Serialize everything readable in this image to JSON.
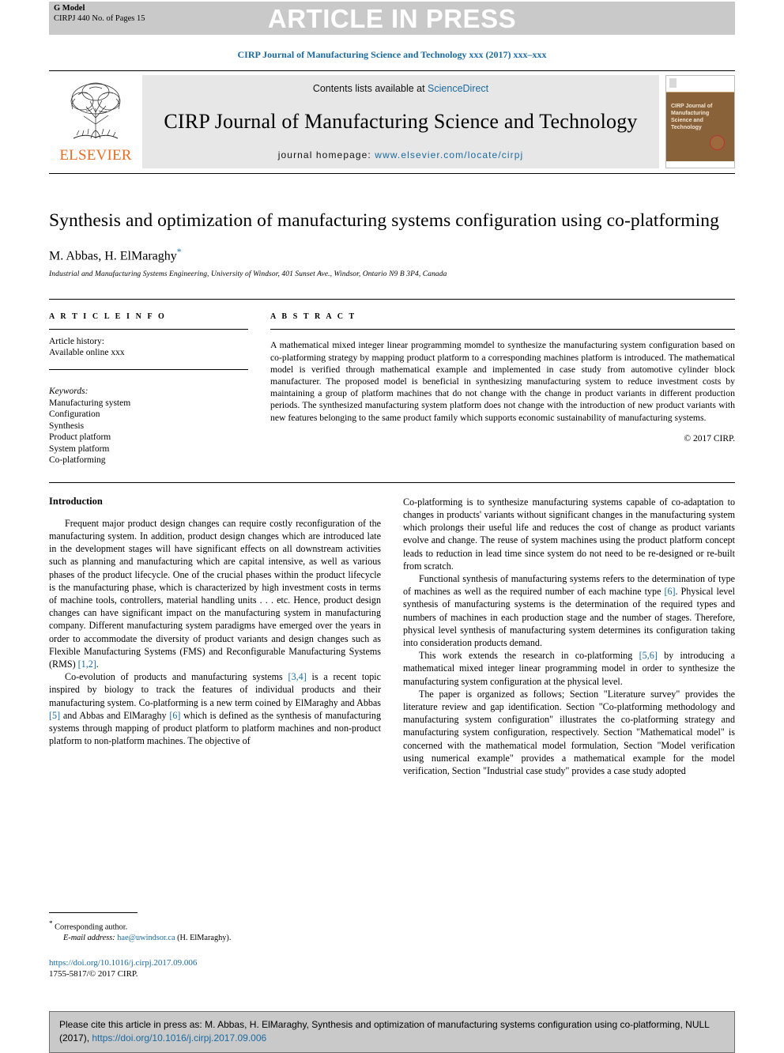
{
  "banner": {
    "g_model_line1": "G Model",
    "g_model_line2": "CIRPJ 440 No. of Pages 15",
    "article_in_press": "ARTICLE IN PRESS"
  },
  "journal_line": "CIRP Journal of Manufacturing Science and Technology xxx (2017) xxx–xxx",
  "masthead": {
    "publisher": "ELSEVIER",
    "contents_prefix": "Contents lists available at ",
    "contents_link": "ScienceDirect",
    "journal_title": "CIRP Journal of Manufacturing Science and Technology",
    "homepage_prefix": "journal homepage: ",
    "homepage_url": "www.elsevier.com/locate/cirpj",
    "cover_title": "CIRP Journal of Manufacturing Science and Technology"
  },
  "article": {
    "title": "Synthesis and optimization of manufacturing systems configuration using co-platforming",
    "authors": "M. Abbas, H. ElMaraghy",
    "corresponding_marker": "*",
    "affiliation": "Industrial and Manufacturing Systems Engineering, University of Windsor, 401 Sunset Ave., Windsor, Ontario N9 B 3P4, Canada"
  },
  "article_info": {
    "heading": "A R T I C L E   I N F O",
    "history_label": "Article history:",
    "history_value": "Available online xxx",
    "keywords_label": "Keywords:",
    "keywords": [
      "Manufacturing system",
      "Configuration",
      "Synthesis",
      "Product platform",
      "System platform",
      "Co-platforming"
    ]
  },
  "abstract": {
    "heading": "A B S T R A C T",
    "text": "A mathematical mixed integer linear programming momdel to synthesize the manufacturing system configuration based on co-platforming strategy by mapping product platform to a corresponding machines platform is introduced. The mathematical model is verified through mathematical example and implemented in case study from automotive cylinder block manufacturer. The proposed model is beneficial in synthesizing manufacturing system to reduce investment costs by maintaining a group of platform machines that do not change with the change in product variants in different production periods. The synthesized manufacturing system platform does not change with the introduction of new product variants with new features belonging to the same product family which supports economic sustainability of manufacturing systems.",
    "copyright": "© 2017 CIRP."
  },
  "body": {
    "section_heading": "Introduction",
    "left_paragraphs": [
      {
        "parts": [
          {
            "t": "Frequent major product design changes can require costly reconfiguration of the manufacturing system. In addition, product design changes which are introduced late in the development stages will have significant effects on all downstream activities such as planning and manufacturing which are capital intensive, as well as various phases of the product lifecycle. One of the crucial phases within the product lifecycle is the manufacturing phase, which is characterized by high investment costs in terms of machine tools, controllers, material handling units . . . etc. Hence, product design changes can have significant impact on the manufacturing system in manufacturing company. Different manufacturing system paradigms have emerged over the years in order to accommodate the diversity of product variants and design changes such as Flexible Manufacturing Systems (FMS) and Reconfigurable Manufacturing Systems (RMS) "
          },
          {
            "t": "[1,2]",
            "ref": true
          },
          {
            "t": "."
          }
        ]
      },
      {
        "parts": [
          {
            "t": "Co-evolution of products and manufacturing systems "
          },
          {
            "t": "[3,4]",
            "ref": true
          },
          {
            "t": " is a recent topic inspired by biology to track the features of individual products and their manufacturing system. Co-platforming is a new term coined by ElMaraghy and Abbas "
          },
          {
            "t": "[5]",
            "ref": true
          },
          {
            "t": " and Abbas and ElMaraghy "
          },
          {
            "t": "[6]",
            "ref": true
          },
          {
            "t": " which is defined as the synthesis of manufacturing systems through mapping of product platform to platform machines and non-product platform to non-platform machines. The objective of"
          }
        ]
      }
    ],
    "right_paragraphs": [
      {
        "no_indent": true,
        "parts": [
          {
            "t": "Co-platforming is to synthesize manufacturing systems capable of co-adaptation to changes in products' variants without significant changes in the manufacturing system which prolongs their useful life and reduces the cost of change as product variants evolve and change. The reuse of system machines using the product platform concept leads to reduction in lead time since system do not need to be re-designed or re-built from scratch."
          }
        ]
      },
      {
        "parts": [
          {
            "t": "Functional synthesis of manufacturing systems refers to the determination of type of machines as well as the required number of each machine type "
          },
          {
            "t": "[6]",
            "ref": true
          },
          {
            "t": ". Physical level synthesis of manufacturing systems is the determination of the required types and numbers of machines in each production stage and the number of stages. Therefore, physical level synthesis of manufacturing system determines its configuration taking into consideration products demand."
          }
        ]
      },
      {
        "parts": [
          {
            "t": "This work extends the research in co-platforming "
          },
          {
            "t": "[5,6]",
            "ref": true
          },
          {
            "t": " by introducing a mathematical mixed integer linear programming model in order to synthesize the manufacturing system configuration at the physical level."
          }
        ]
      },
      {
        "parts": [
          {
            "t": "The paper is organized as follows; Section \"Literature survey\" provides the literature review and gap identification. Section \"Co-platforming methodology and manufacturing system configuration\" illustrates the co-platforming strategy and manufacturing system configuration, respectively. Section \"Mathematical model\" is concerned with the mathematical model formulation, Section \"Model verification using numerical example\" provides a mathematical example for the model verification, Section \"Industrial case study\" provides a case study adopted"
          }
        ]
      }
    ]
  },
  "footnote": {
    "corresponding": "Corresponding author.",
    "email_label": "E-mail address:",
    "email": "hae@uwindsor.ca",
    "email_owner": "(H. ElMaraghy).",
    "doi": "https://doi.org/10.1016/j.cirpj.2017.09.006",
    "issn_line": "1755-5817/© 2017 CIRP."
  },
  "cite_box": {
    "text_before": "Please cite this article in press as: M. Abbas, H. ElMaraghy, Synthesis and optimization of manufacturing systems configuration using co-platforming, NULL (2017), ",
    "doi": "https://doi.org/10.1016/j.cirpj.2017.09.006"
  },
  "colors": {
    "link": "#1a6aa0",
    "banner_grey": "#c9c9c9",
    "masthead_grey": "#e7e7e7",
    "elsevier_orange": "#E86C25"
  }
}
